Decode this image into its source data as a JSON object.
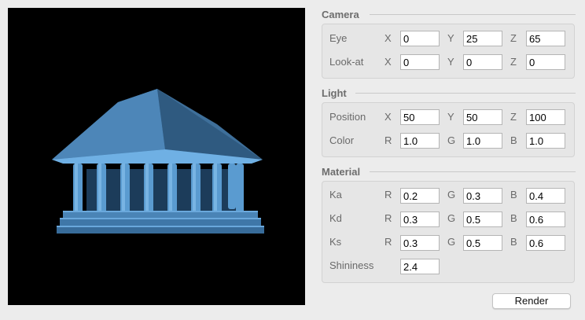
{
  "camera": {
    "title": "Camera",
    "eye": {
      "label": "Eye",
      "x": "0",
      "y": "25",
      "z": "65"
    },
    "look_at": {
      "label": "Look-at",
      "x": "0",
      "y": "0",
      "z": "0"
    }
  },
  "light": {
    "title": "Light",
    "position": {
      "label": "Position",
      "x": "50",
      "y": "50",
      "z": "100"
    },
    "color": {
      "label": "Color",
      "r": "1.0",
      "g": "1.0",
      "b": "1.0"
    }
  },
  "material": {
    "title": "Material",
    "ka": {
      "label": "Ka",
      "r": "0.2",
      "g": "0.3",
      "b": "0.4"
    },
    "kd": {
      "label": "Kd",
      "r": "0.3",
      "g": "0.5",
      "b": "0.6"
    },
    "ks": {
      "label": "Ks",
      "r": "0.3",
      "g": "0.5",
      "b": "0.6"
    },
    "shininess": {
      "label": "Shininess",
      "value": "2.4"
    }
  },
  "axes": {
    "x": "X",
    "y": "Y",
    "z": "Z",
    "r": "R",
    "g": "G",
    "b": "B"
  },
  "render_button": "Render",
  "colors": {
    "viewport_bg": "#000000",
    "model": "#4a90c8"
  }
}
